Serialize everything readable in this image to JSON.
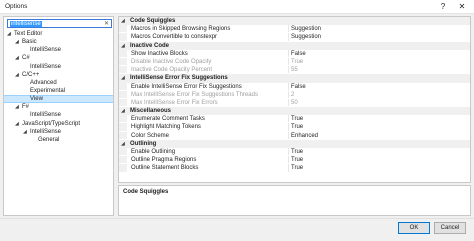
{
  "window": {
    "title": "Options",
    "help_glyph": "?",
    "close_glyph": "✕"
  },
  "search": {
    "value": "intellisense",
    "clear_glyph": "✕"
  },
  "tree": [
    {
      "label": "Text Editor",
      "arrow": "◢",
      "selected": false
    },
    {
      "label": "Basic",
      "arrow": "◢",
      "selected": false
    },
    {
      "label": "IntelliSense",
      "arrow": "",
      "selected": false
    },
    {
      "label": "C#",
      "arrow": "◢",
      "selected": false
    },
    {
      "label": "IntelliSense",
      "arrow": "",
      "selected": false
    },
    {
      "label": "C/C++",
      "arrow": "◢",
      "selected": false
    },
    {
      "label": "Advanced",
      "arrow": "",
      "selected": false
    },
    {
      "label": "Experimental",
      "arrow": "",
      "selected": false
    },
    {
      "label": "View",
      "arrow": "",
      "selected": true
    },
    {
      "label": "F#",
      "arrow": "◢",
      "selected": false
    },
    {
      "label": "IntelliSense",
      "arrow": "",
      "selected": false
    },
    {
      "label": "JavaScript/TypeScript",
      "arrow": "◢",
      "selected": false
    },
    {
      "label": "IntelliSense",
      "arrow": "◢",
      "selected": false
    },
    {
      "label": "General",
      "arrow": "",
      "selected": false
    }
  ],
  "properties": [
    {
      "type": "cat",
      "name": "Code Squiggles"
    },
    {
      "type": "item",
      "name": "Macros in Skipped Browsing Regions",
      "value": "Suggestion",
      "disabled": false
    },
    {
      "type": "item",
      "name": "Macros Convertible to constexpr",
      "value": "Suggestion",
      "disabled": false
    },
    {
      "type": "cat",
      "name": "Inactive Code"
    },
    {
      "type": "item",
      "name": "Show Inactive Blocks",
      "value": "False",
      "disabled": false
    },
    {
      "type": "item",
      "name": "Disable Inactive Code Opacity",
      "value": "True",
      "disabled": true
    },
    {
      "type": "item",
      "name": "Inactive Code Opacity Percent",
      "value": "55",
      "disabled": true
    },
    {
      "type": "cat",
      "name": "IntelliSense Error Fix Suggestions"
    },
    {
      "type": "item",
      "name": "Enable IntelliSense Error Fix Suggestions",
      "value": "False",
      "disabled": false
    },
    {
      "type": "item",
      "name": "Max IntelliSense Error Fix Suggestions Threads",
      "value": "2",
      "disabled": true
    },
    {
      "type": "item",
      "name": "Max IntelliSense Error Fix Errors",
      "value": "50",
      "disabled": true
    },
    {
      "type": "cat",
      "name": "Miscellaneous"
    },
    {
      "type": "item",
      "name": "Enumerate Comment Tasks",
      "value": "True",
      "disabled": false
    },
    {
      "type": "item",
      "name": "Highlight Matching Tokens",
      "value": "True",
      "disabled": false
    },
    {
      "type": "item",
      "name": "Color Scheme",
      "value": "Enhanced",
      "disabled": false
    },
    {
      "type": "cat",
      "name": "Outlining"
    },
    {
      "type": "item",
      "name": "Enable Outlining",
      "value": "True",
      "disabled": false
    },
    {
      "type": "item",
      "name": "Outline Pragma Regions",
      "value": "True",
      "disabled": false
    },
    {
      "type": "item",
      "name": "Outline Statement Blocks",
      "value": "True",
      "disabled": false
    }
  ],
  "description": {
    "title": "Code Squiggles"
  },
  "buttons": {
    "ok": "OK",
    "cancel": "Cancel"
  },
  "colors": {
    "selection": "#cce8ff",
    "accent": "#0078d7",
    "disabled_text": "#a0a0a0"
  }
}
